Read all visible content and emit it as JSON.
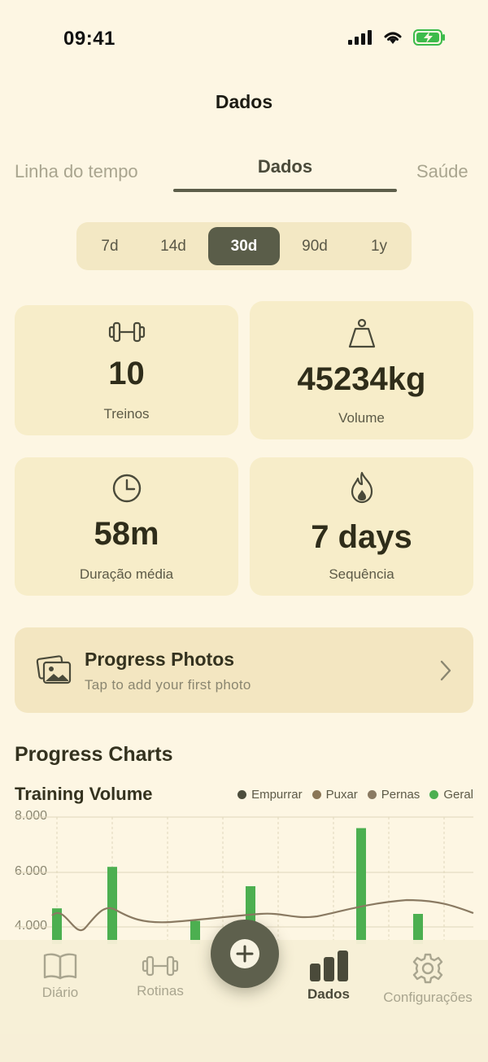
{
  "status": {
    "time": "09:41"
  },
  "header": {
    "title": "Dados"
  },
  "tabs": [
    {
      "label": "Linha do tempo"
    },
    {
      "label": "Dados"
    },
    {
      "label": "Saúde"
    }
  ],
  "ranges": [
    {
      "label": "7d"
    },
    {
      "label": "14d"
    },
    {
      "label": "30d"
    },
    {
      "label": "90d"
    },
    {
      "label": "1y"
    }
  ],
  "selected_range": "30d",
  "stats": [
    {
      "icon": "dumbbell-icon",
      "value": "10",
      "label": "Treinos"
    },
    {
      "icon": "weight-icon",
      "value": "45234kg",
      "label": "Volume"
    },
    {
      "icon": "clock-icon",
      "value": "58m",
      "label": "Duração média"
    },
    {
      "icon": "flame-icon",
      "value": "7 days",
      "label": "Sequência"
    }
  ],
  "photos": {
    "title": "Progress Photos",
    "subtitle": "Tap to add your first photo"
  },
  "charts": {
    "section_title": "Progress Charts"
  },
  "chart_data": {
    "type": "bar",
    "title": "Training Volume",
    "y_ticks": [
      "8.000",
      "6.000",
      "4.000"
    ],
    "ylim": [
      3500,
      8000
    ],
    "legend": [
      {
        "name": "Empurrar",
        "color": "#4d4d3c"
      },
      {
        "name": "Puxar",
        "color": "#8a7656"
      },
      {
        "name": "Pernas",
        "color": "#8a7a62"
      },
      {
        "name": "Geral",
        "color": "#4caf50"
      }
    ],
    "series": [
      {
        "name": "Geral",
        "values": [
          4700,
          6200,
          4250,
          5500,
          7600,
          4500
        ]
      }
    ]
  },
  "nav": [
    {
      "label": "Diário",
      "icon": "book-icon"
    },
    {
      "label": "Rotinas",
      "icon": "dumbbell-icon"
    },
    {
      "label": "Dados",
      "icon": "bar-chart-icon"
    },
    {
      "label": "Configurações",
      "icon": "gear-icon"
    }
  ],
  "colors": {
    "background": "#fdf6e3",
    "card": "#f7edc9",
    "accent": "#5a5d49",
    "bar": "#4caf50"
  }
}
